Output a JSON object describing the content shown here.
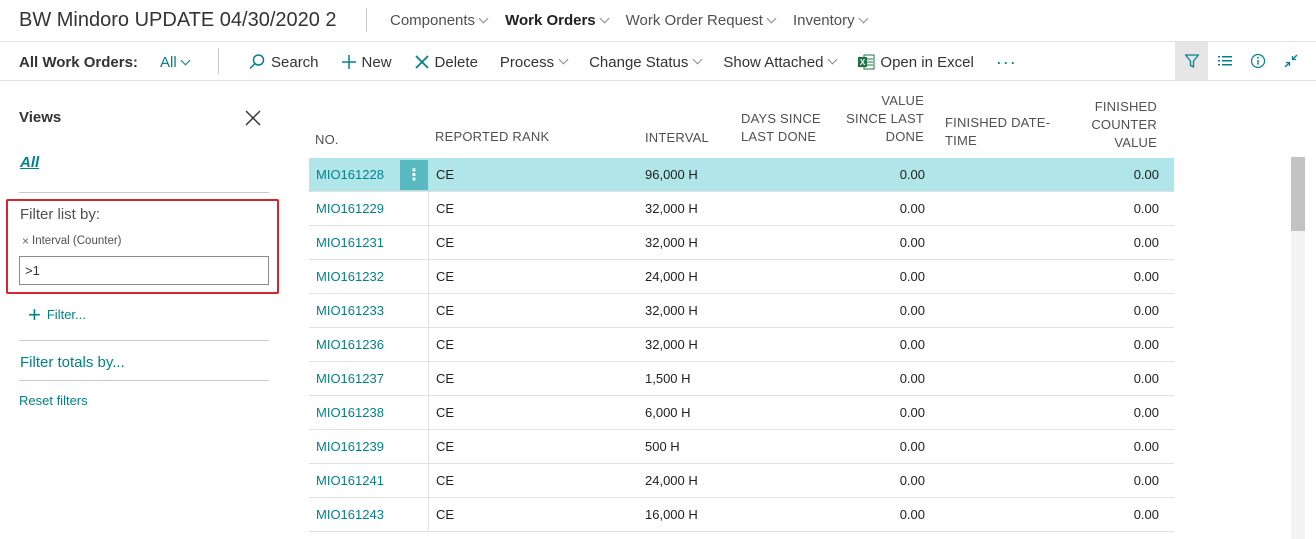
{
  "app_title": "BW Mindoro UPDATE 04/30/2020 2",
  "nav": [
    {
      "label": "Components",
      "active": false
    },
    {
      "label": "Work Orders",
      "active": true
    },
    {
      "label": "Work Order Request",
      "active": false
    },
    {
      "label": "Inventory",
      "active": false
    }
  ],
  "actionbar": {
    "view_label": "All Work Orders:",
    "view_value": "All",
    "search": "Search",
    "new": "New",
    "delete": "Delete",
    "process": "Process",
    "change_status": "Change Status",
    "show_attached": "Show Attached",
    "open_in_excel": "Open in Excel",
    "more": "···"
  },
  "tools": [
    "filter-icon",
    "list-icon",
    "info-icon",
    "collapse-icon"
  ],
  "filter_pane": {
    "views_title": "Views",
    "all_view": "All",
    "filter_list_by": "Filter list by:",
    "active_filter_field": "Interval (Counter)",
    "filter_value": ">1",
    "add_filter": "Filter...",
    "filter_totals_by": "Filter totals by...",
    "reset_filters": "Reset filters"
  },
  "table": {
    "columns": {
      "no": "No.",
      "reported_rank": "Reported Rank",
      "interval": "Interval",
      "days_since_line1": "Days Since",
      "days_since_line2": "Last Done",
      "value_since_line1": "Value",
      "value_since_line2": "Since Last",
      "value_since_line3": "Done",
      "finished_dt_line1": "Finished Date-",
      "finished_dt_line2": "Time",
      "finished_cv_line1": "Finished",
      "finished_cv_line2": "Counter",
      "finished_cv_line3": "Value"
    },
    "rows": [
      {
        "no": "MIO161228",
        "rank": "CE",
        "interval": "96,000 H",
        "value_since": "0.00",
        "finished_counter": "0.00",
        "selected": true
      },
      {
        "no": "MIO161229",
        "rank": "CE",
        "interval": "32,000 H",
        "value_since": "0.00",
        "finished_counter": "0.00"
      },
      {
        "no": "MIO161231",
        "rank": "CE",
        "interval": "32,000 H",
        "value_since": "0.00",
        "finished_counter": "0.00"
      },
      {
        "no": "MIO161232",
        "rank": "CE",
        "interval": "24,000 H",
        "value_since": "0.00",
        "finished_counter": "0.00"
      },
      {
        "no": "MIO161233",
        "rank": "CE",
        "interval": "32,000 H",
        "value_since": "0.00",
        "finished_counter": "0.00"
      },
      {
        "no": "MIO161236",
        "rank": "CE",
        "interval": "32,000 H",
        "value_since": "0.00",
        "finished_counter": "0.00"
      },
      {
        "no": "MIO161237",
        "rank": "CE",
        "interval": "1,500 H",
        "value_since": "0.00",
        "finished_counter": "0.00"
      },
      {
        "no": "MIO161238",
        "rank": "CE",
        "interval": "6,000 H",
        "value_since": "0.00",
        "finished_counter": "0.00"
      },
      {
        "no": "MIO161239",
        "rank": "CE",
        "interval": "500 H",
        "value_since": "0.00",
        "finished_counter": "0.00"
      },
      {
        "no": "MIO161241",
        "rank": "CE",
        "interval": "24,000 H",
        "value_since": "0.00",
        "finished_counter": "0.00"
      },
      {
        "no": "MIO161243",
        "rank": "CE",
        "interval": "16,000 H",
        "value_since": "0.00",
        "finished_counter": "0.00"
      }
    ],
    "row_menu_glyph": "⋮"
  },
  "colors": {
    "accent": "#00828a",
    "selected_row": "#b0e6e9",
    "highlight_box": "#d9232e",
    "excel_green": "#217346"
  }
}
